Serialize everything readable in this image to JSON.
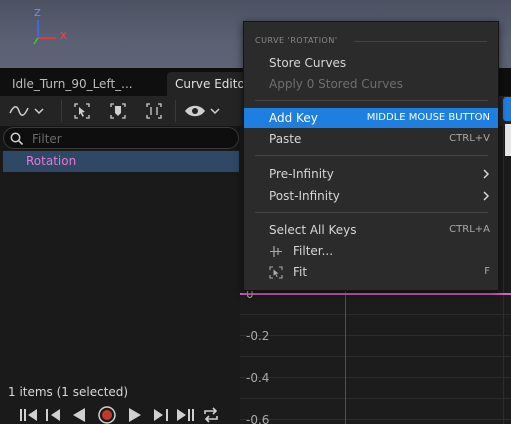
{
  "viewport": {
    "axes": {
      "z": "Z",
      "x": "X"
    }
  },
  "tabs": [
    {
      "label": "Idle_Turn_90_Left_..."
    },
    {
      "label": "Curve Editor"
    }
  ],
  "search": {
    "placeholder": "Filter"
  },
  "curve_list": {
    "rows": [
      {
        "label": "Rotation",
        "color": "#e07ad8"
      }
    ]
  },
  "status": {
    "items_text": "1 items (1 selected)"
  },
  "graph": {
    "y_labels": [
      "0",
      "-0.2",
      "-0.4",
      "-0.6"
    ],
    "curve_color": "#d95fc7"
  },
  "context_menu": {
    "title": "CURVE 'ROTATION'",
    "items": [
      {
        "label": "Store Curves",
        "shortcut": ""
      },
      {
        "label": "Apply 0 Stored Curves",
        "shortcut": "",
        "disabled": true
      },
      {
        "label": "Add Key",
        "shortcut": "MIDDLE MOUSE BUTTON",
        "highlighted": true
      },
      {
        "label": "Paste",
        "shortcut": "CTRL+V"
      },
      {
        "label": "Pre-Infinity",
        "submenu": true
      },
      {
        "label": "Post-Infinity",
        "submenu": true
      },
      {
        "label": "Select All Keys",
        "shortcut": "CTRL+A"
      },
      {
        "label": "Filter...",
        "icon": "filter-icon"
      },
      {
        "label": "Fit",
        "shortcut": "F",
        "icon": "fit-icon"
      }
    ]
  },
  "colors": {
    "accent": "#1e7fe0",
    "selection": "#2f4865",
    "record": "#c0392b"
  },
  "icons": {
    "toolbar": [
      "curve-type-icon",
      "select-icon",
      "key-mode-icon",
      "frame-icon",
      "eye-icon"
    ],
    "transport": [
      "go-start-icon",
      "step-back-icon",
      "play-reverse-icon",
      "record-icon",
      "play-icon",
      "step-forward-icon",
      "go-end-icon",
      "loop-icon"
    ]
  }
}
